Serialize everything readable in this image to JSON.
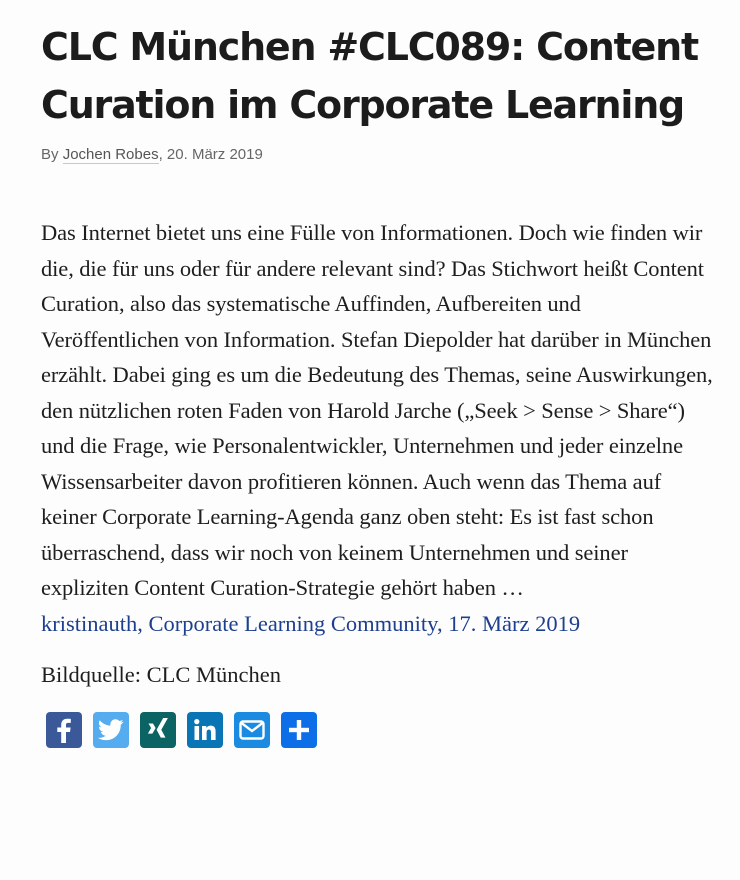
{
  "post": {
    "title": "CLC München #CLC089: Content Curation im Corporate Learning",
    "byline_prefix": "By",
    "author": "Jochen Robes",
    "date": ", 20. März 2019",
    "excerpt": "Das Internet bietet uns eine Fülle von Informationen. Doch wie finden wir die, die für uns oder für andere relevant sind? Das Stichwort heißt Content Curation, also das systematische Auffinden, Aufbereiten und Veröffentlichen von Information. Stefan Diepolder hat darüber in München erzählt. Dabei ging es um die Bedeutung des Themas, seine Auswirkungen, den nützlichen roten Faden von Harold Jarche („Seek > Sense > Share“) und die Frage, wie Personalentwickler, Unternehmen und jeder einzelne Wissensarbeiter davon profitieren können. Auch wenn das Thema auf keiner Corporate Learning-Agenda ganz oben steht: Es ist fast schon überraschend, dass wir noch von keinem Unternehmen und seiner expliziten Content Curation-Strategie gehört haben …",
    "source_link": "kristinauth, Corporate Learning Community, 17. März 2019",
    "image_credit": "Bildquelle: CLC München"
  },
  "share": [
    {
      "name": "facebook-icon",
      "color": "#3b5998"
    },
    {
      "name": "twitter-icon",
      "color": "#55acee"
    },
    {
      "name": "xing-icon",
      "color": "#0c6364"
    },
    {
      "name": "linkedin-icon",
      "color": "#0a75b5"
    },
    {
      "name": "email-icon",
      "color": "#1a8be0"
    },
    {
      "name": "share-plus-icon",
      "color": "#0c6fe8"
    }
  ],
  "colors": {
    "link": "#1d3f8f",
    "text": "#1e1e1e",
    "meta": "#666666"
  }
}
